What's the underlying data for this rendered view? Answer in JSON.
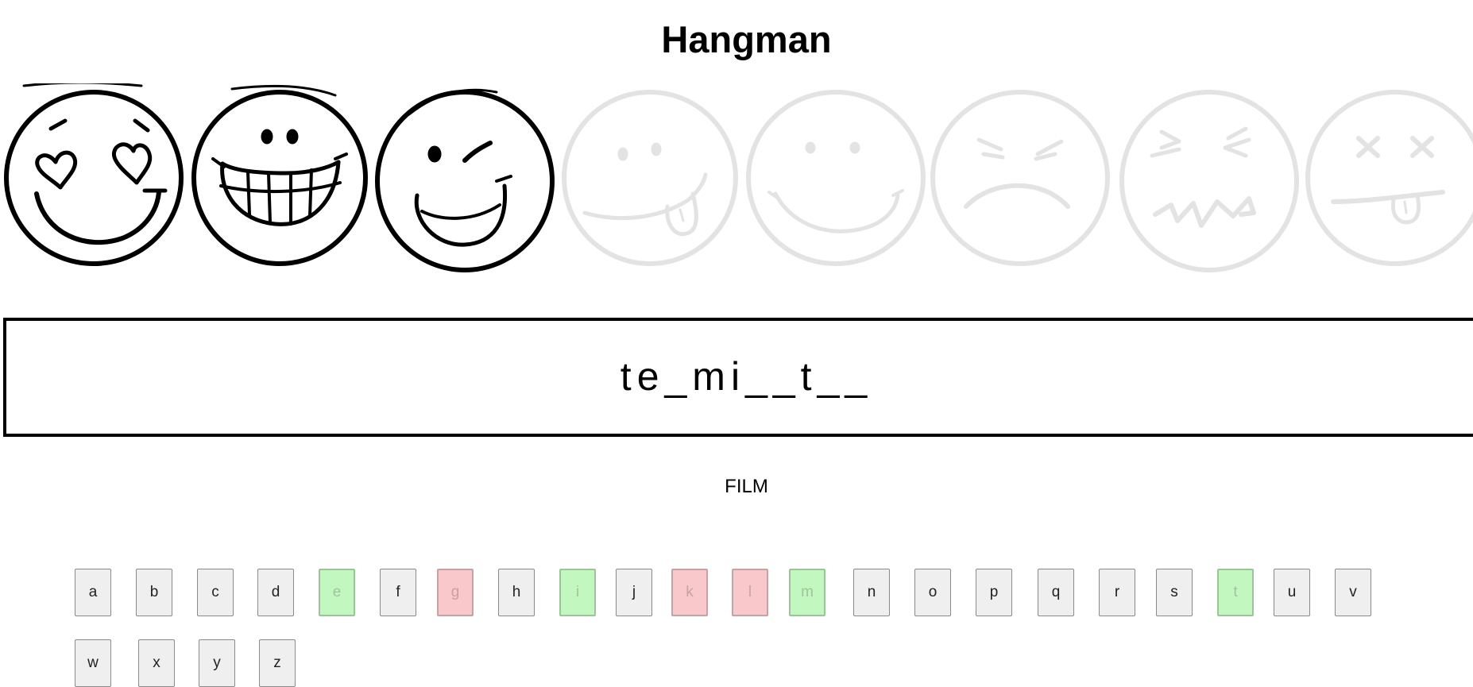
{
  "title": "Hangman",
  "word_display": "te_mi__t__",
  "category": "FILM",
  "faces": [
    {
      "icon": "heart-eyes-face-icon",
      "state": "active"
    },
    {
      "icon": "grinning-teeth-face-icon",
      "state": "active"
    },
    {
      "icon": "winking-face-icon",
      "state": "active"
    },
    {
      "icon": "tongue-out-face-icon",
      "state": "inactive"
    },
    {
      "icon": "smiling-face-icon",
      "state": "inactive"
    },
    {
      "icon": "frowning-face-icon",
      "state": "inactive"
    },
    {
      "icon": "squinting-face-icon",
      "state": "inactive"
    },
    {
      "icon": "dead-face-icon",
      "state": "inactive"
    }
  ],
  "keyboard": [
    {
      "letter": "a",
      "state": "unused"
    },
    {
      "letter": "b",
      "state": "unused"
    },
    {
      "letter": "c",
      "state": "unused"
    },
    {
      "letter": "d",
      "state": "unused"
    },
    {
      "letter": "e",
      "state": "correct"
    },
    {
      "letter": "f",
      "state": "unused"
    },
    {
      "letter": "g",
      "state": "wrong"
    },
    {
      "letter": "h",
      "state": "unused"
    },
    {
      "letter": "i",
      "state": "correct"
    },
    {
      "letter": "j",
      "state": "unused"
    },
    {
      "letter": "k",
      "state": "wrong"
    },
    {
      "letter": "l",
      "state": "wrong"
    },
    {
      "letter": "m",
      "state": "correct"
    },
    {
      "letter": "n",
      "state": "unused"
    },
    {
      "letter": "o",
      "state": "unused"
    },
    {
      "letter": "p",
      "state": "unused"
    },
    {
      "letter": "q",
      "state": "unused"
    },
    {
      "letter": "r",
      "state": "unused"
    },
    {
      "letter": "s",
      "state": "unused"
    },
    {
      "letter": "t",
      "state": "correct"
    },
    {
      "letter": "u",
      "state": "unused"
    },
    {
      "letter": "v",
      "state": "unused"
    },
    {
      "letter": "w",
      "state": "unused"
    },
    {
      "letter": "x",
      "state": "unused"
    },
    {
      "letter": "y",
      "state": "unused"
    },
    {
      "letter": "z",
      "state": "unused"
    }
  ],
  "colors": {
    "active_stroke": "#000000",
    "inactive_stroke": "#e3e3e3",
    "correct_bg": "#c3f7c0",
    "wrong_bg": "#f8c8cb"
  }
}
